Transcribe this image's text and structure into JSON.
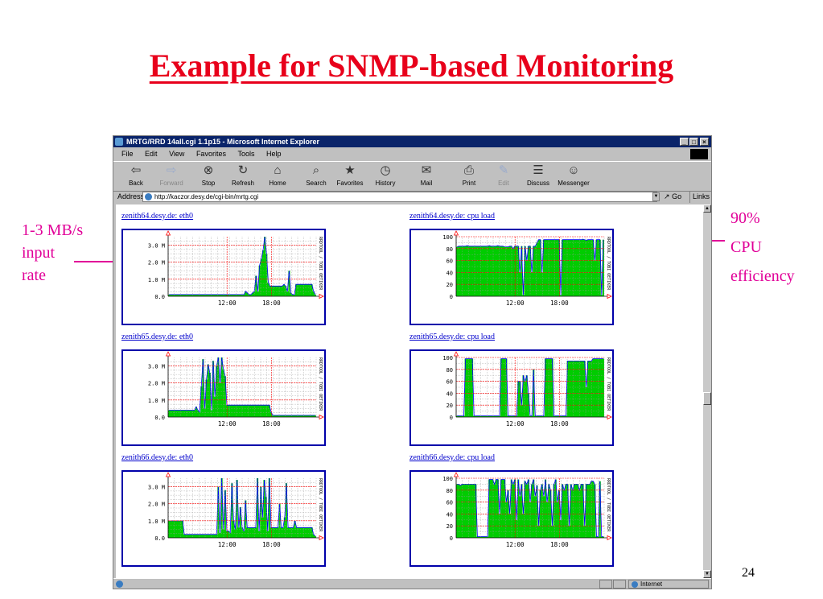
{
  "slide": {
    "title": "Example for SNMP-based Monitoring",
    "annotation_left": [
      "1-3 MB/s",
      "input",
      "rate"
    ],
    "annotation_right": [
      "90%",
      "CPU",
      "efficiency"
    ],
    "page_number": "24"
  },
  "browser": {
    "title": "MRTG/RRD 14all.cgi 1.1p15 - Microsoft Internet Explorer",
    "window_buttons": [
      "_",
      "□",
      "×"
    ],
    "menu": [
      "File",
      "Edit",
      "View",
      "Favorites",
      "Tools",
      "Help"
    ],
    "toolbar": [
      {
        "label": "Back",
        "icon": "⇦"
      },
      {
        "label": "Forward",
        "icon": "⇨"
      },
      {
        "label": "Stop",
        "icon": "⊗"
      },
      {
        "label": "Refresh",
        "icon": "↻"
      },
      {
        "label": "Home",
        "icon": "⌂"
      },
      {
        "label": "Search",
        "icon": "⌕"
      },
      {
        "label": "Favorites",
        "icon": "★"
      },
      {
        "label": "History",
        "icon": "◷"
      },
      {
        "label": "Mail",
        "icon": "✉"
      },
      {
        "label": "Print",
        "icon": "⎙"
      },
      {
        "label": "Edit",
        "icon": "✎"
      },
      {
        "label": "Discuss",
        "icon": "☰"
      },
      {
        "label": "Messenger",
        "icon": "☺"
      }
    ],
    "address_label": "Address",
    "address": "http://kaczor.desy.de/cgi-bin/mrtg.cgi",
    "go_label": "Go",
    "links_label": "Links",
    "status_zone": "Internet"
  },
  "graphs": [
    {
      "link": "zenith64.desy.de: eth0",
      "kind": "eth"
    },
    {
      "link": "zenith64.desy.de: cpu load",
      "kind": "cpu"
    },
    {
      "link": "zenith65.desy.de: eth0",
      "kind": "eth"
    },
    {
      "link": "zenith65.desy.de: cpu load",
      "kind": "cpu"
    },
    {
      "link": "zenith66.desy.de: eth0",
      "kind": "eth"
    },
    {
      "link": "zenith66.desy.de: cpu load",
      "kind": "cpu"
    }
  ],
  "axes": {
    "eth_ticks": [
      "3.0 M",
      "2.0 M",
      "1.0 M",
      "0.0"
    ],
    "cpu_ticks": [
      "100",
      "80",
      "60",
      "40",
      "20",
      "0"
    ],
    "x_ticks": [
      "12:00",
      "18:00"
    ],
    "side_label": "RRDTOOL / TOBI OETIKER"
  },
  "chart_data": [
    {
      "type": "area",
      "series_color": "#00cc00",
      "ylim": [
        0,
        3.5
      ],
      "unit": "M",
      "x_ticks": [
        "12:00",
        "18:00"
      ],
      "values": [
        0.1,
        0.1,
        0.1,
        0.1,
        0.1,
        0.1,
        0.1,
        0.1,
        0.1,
        0.1,
        0.1,
        0.1,
        0.1,
        0.1,
        0.1,
        0.1,
        0.1,
        0.1,
        0.1,
        0.1,
        0.1,
        0.1,
        0.1,
        0.1,
        0.1,
        0.1,
        0.1,
        0.1,
        0.1,
        0.1,
        0.1,
        0.1,
        0.1,
        0.1,
        0.1,
        0.1,
        0.1,
        0.1,
        0.1,
        0.1,
        0.1,
        0.1,
        0.1,
        0.1,
        0.3,
        0.2,
        0.1,
        0.1,
        0.2,
        0.3,
        1.2,
        0.3,
        1.8,
        2.2,
        2.7,
        3.6,
        2.5,
        0.8,
        0.6,
        0.6,
        0.6,
        0.6,
        0.6,
        0.6,
        0.6,
        0.6,
        0.7,
        0.6,
        0.3,
        1.5,
        0.2,
        0.1,
        0.1,
        0.7,
        0.7,
        0.7,
        0.7,
        0.7,
        0.7,
        0.7,
        0.7,
        0.7,
        0.7,
        0.3,
        0.1
      ]
    },
    {
      "type": "area",
      "series_color": "#00cc00",
      "ylim": [
        0,
        100
      ],
      "x_ticks": [
        "12:00",
        "18:00"
      ],
      "values": [
        83,
        84,
        84,
        84,
        84,
        84,
        85,
        84,
        84,
        84,
        84,
        84,
        84,
        84,
        84,
        84,
        84,
        84,
        84,
        85,
        84,
        84,
        84,
        84,
        85,
        84,
        84,
        84,
        83,
        83,
        83,
        84,
        84,
        80,
        84,
        84,
        84,
        40,
        84,
        2,
        84,
        60,
        84,
        84,
        40,
        84,
        84,
        90,
        95,
        95,
        40,
        95,
        95,
        95,
        95,
        95,
        95,
        95,
        95,
        95,
        95,
        2,
        95,
        95,
        95,
        95,
        95,
        95,
        95,
        95,
        95,
        95,
        95,
        95,
        96,
        95,
        94,
        95,
        95,
        95,
        95,
        60,
        95,
        95,
        95,
        2,
        95
      ]
    },
    {
      "type": "area",
      "series_color": "#00cc00",
      "ylim": [
        0,
        3.5
      ],
      "unit": "M",
      "x_ticks": [
        "12:00",
        "18:00"
      ],
      "values": [
        0.4,
        0.4,
        0.4,
        0.4,
        0.4,
        0.4,
        0.4,
        0.4,
        0.4,
        0.4,
        0.4,
        0.4,
        0.4,
        0.4,
        0.4,
        0.4,
        0.4,
        0.4,
        0.4,
        0.4,
        0.4,
        0.4,
        0.4,
        0.4,
        0.4,
        0.4,
        0.4,
        0.4,
        0.4,
        0.4,
        0.4,
        0.4,
        0.4,
        0.4,
        0.4,
        0.4,
        0.4,
        0.4,
        0.4,
        0.4,
        0.4,
        0.4,
        0.4,
        0.4,
        0.4,
        0.4,
        0.4,
        0.4,
        0.4,
        0.4,
        0.4,
        0.4,
        0.4,
        0.4,
        0.4,
        0.4,
        0.4,
        0.4,
        0.4,
        0.4,
        0.4,
        0.4,
        0.4,
        0.4,
        0.4,
        0.4,
        0.4,
        0.4,
        0.4,
        0.4,
        0.4,
        0.4,
        0.4,
        0.4,
        0.4,
        0.4,
        0.4,
        0.4,
        0.4,
        0.4,
        0.4,
        0.4,
        0.4,
        0.4,
        0.4,
        0.4,
        0.4
      ],
      "overrides": [
        [
          0,
          0.4
        ],
        [
          1,
          0.4
        ],
        [
          16,
          0.6
        ],
        [
          17,
          0.4
        ],
        [
          18,
          0.3
        ],
        [
          19,
          1.8
        ],
        [
          20,
          3.4
        ],
        [
          21,
          0.5
        ],
        [
          22,
          2.2
        ],
        [
          23,
          3.1
        ],
        [
          24,
          2.6
        ],
        [
          25,
          0.4
        ],
        [
          26,
          3.3
        ],
        [
          27,
          1.2
        ],
        [
          28,
          3.0
        ],
        [
          29,
          3.6
        ],
        [
          30,
          2.0
        ],
        [
          31,
          3.5
        ],
        [
          32,
          2.8
        ],
        [
          33,
          2.4
        ],
        [
          34,
          0.7
        ],
        [
          35,
          0.7
        ],
        [
          36,
          0.7
        ],
        [
          37,
          0.7
        ],
        [
          38,
          0.7
        ],
        [
          39,
          0.7
        ],
        [
          40,
          0.7
        ],
        [
          41,
          0.7
        ],
        [
          42,
          0.7
        ],
        [
          43,
          0.7
        ],
        [
          44,
          0.7
        ],
        [
          45,
          0.7
        ],
        [
          46,
          0.7
        ],
        [
          47,
          0.7
        ],
        [
          48,
          0.7
        ],
        [
          49,
          0.7
        ],
        [
          50,
          0.7
        ],
        [
          51,
          0.7
        ],
        [
          52,
          0.7
        ],
        [
          53,
          0.7
        ],
        [
          54,
          0.7
        ],
        [
          55,
          0.7
        ],
        [
          56,
          0.7
        ],
        [
          57,
          0.7
        ],
        [
          58,
          0.7
        ],
        [
          59,
          0.7
        ],
        [
          60,
          0.3
        ]
      ]
    },
    {
      "type": "area",
      "series_color": "#00cc00",
      "ylim": [
        0,
        100
      ],
      "x_ticks": [
        "12:00",
        "18:00"
      ],
      "values": [
        2,
        2,
        2,
        2,
        2,
        98,
        98,
        98,
        98,
        98,
        2,
        2,
        2,
        2,
        2,
        2,
        2,
        2,
        2,
        2,
        2,
        2,
        2,
        2,
        2,
        2,
        98,
        98,
        98,
        98,
        2,
        2,
        2,
        2,
        2,
        2,
        60,
        60,
        20,
        70,
        60,
        70,
        40,
        2,
        2,
        80,
        2,
        2,
        2,
        2,
        2,
        2,
        98,
        98,
        98,
        98,
        98,
        2,
        2,
        2,
        2,
        2,
        2,
        2,
        2,
        94,
        94,
        94,
        94,
        94,
        94,
        94,
        94,
        94,
        94,
        94,
        50,
        94,
        94,
        94,
        98,
        98,
        98,
        98,
        98,
        98,
        98
      ]
    },
    {
      "type": "area",
      "series_color": "#00cc00",
      "ylim": [
        0,
        3.5
      ],
      "unit": "M",
      "x_ticks": [
        "12:00",
        "18:00"
      ],
      "values": [
        1.0,
        1.0,
        1.0,
        1.0,
        1.0,
        1.0,
        1.0,
        1.0,
        1.0,
        0.2,
        0.2,
        0.2,
        0.2,
        0.2,
        0.2,
        0.2,
        0.2,
        0.2,
        0.2,
        0.2,
        0.2,
        0.2,
        0.2,
        0.2,
        0.2,
        0.2,
        0.2,
        0.2,
        0.2,
        3.0,
        0.3,
        3.6,
        0.5,
        2.8,
        0.4,
        0.4,
        0.3,
        3.2,
        1.0,
        0.5,
        3.4,
        0.6,
        1.8,
        0.6,
        0.4,
        2.2,
        0.6,
        0.6,
        0.6,
        0.6,
        0.6,
        0.6,
        3.6,
        0.4,
        3.0,
        1.2,
        3.4,
        2.4,
        0.4,
        3.6,
        0.6,
        0.6,
        0.6,
        0.6,
        0.6,
        2.0,
        0.6,
        0.6,
        1.2,
        3.2,
        0.6,
        0.6,
        0.6,
        0.6,
        1.0,
        0.6,
        0.6,
        0.6,
        0.6,
        0.6,
        0.6,
        0.6,
        0.6,
        0.6,
        0.6,
        0.2,
        0.1
      ]
    },
    {
      "type": "area",
      "series_color": "#00cc00",
      "ylim": [
        0,
        100
      ],
      "x_ticks": [
        "12:00",
        "18:00"
      ],
      "values": [
        90,
        90,
        88,
        90,
        90,
        90,
        90,
        90,
        90,
        90,
        90,
        90,
        2,
        2,
        2,
        2,
        2,
        2,
        2,
        98,
        98,
        98,
        90,
        98,
        98,
        40,
        98,
        98,
        98,
        60,
        80,
        40,
        98,
        90,
        98,
        30,
        98,
        70,
        90,
        40,
        95,
        90,
        98,
        60,
        90,
        98,
        70,
        88,
        20,
        80,
        90,
        70,
        98,
        60,
        90,
        80,
        20,
        90,
        98,
        60,
        80,
        30,
        90,
        80,
        90,
        90,
        20,
        90,
        80,
        90,
        90,
        90,
        80,
        90,
        90,
        20,
        90,
        90,
        90,
        95,
        95,
        90,
        2,
        2,
        95,
        2,
        2
      ]
    }
  ]
}
